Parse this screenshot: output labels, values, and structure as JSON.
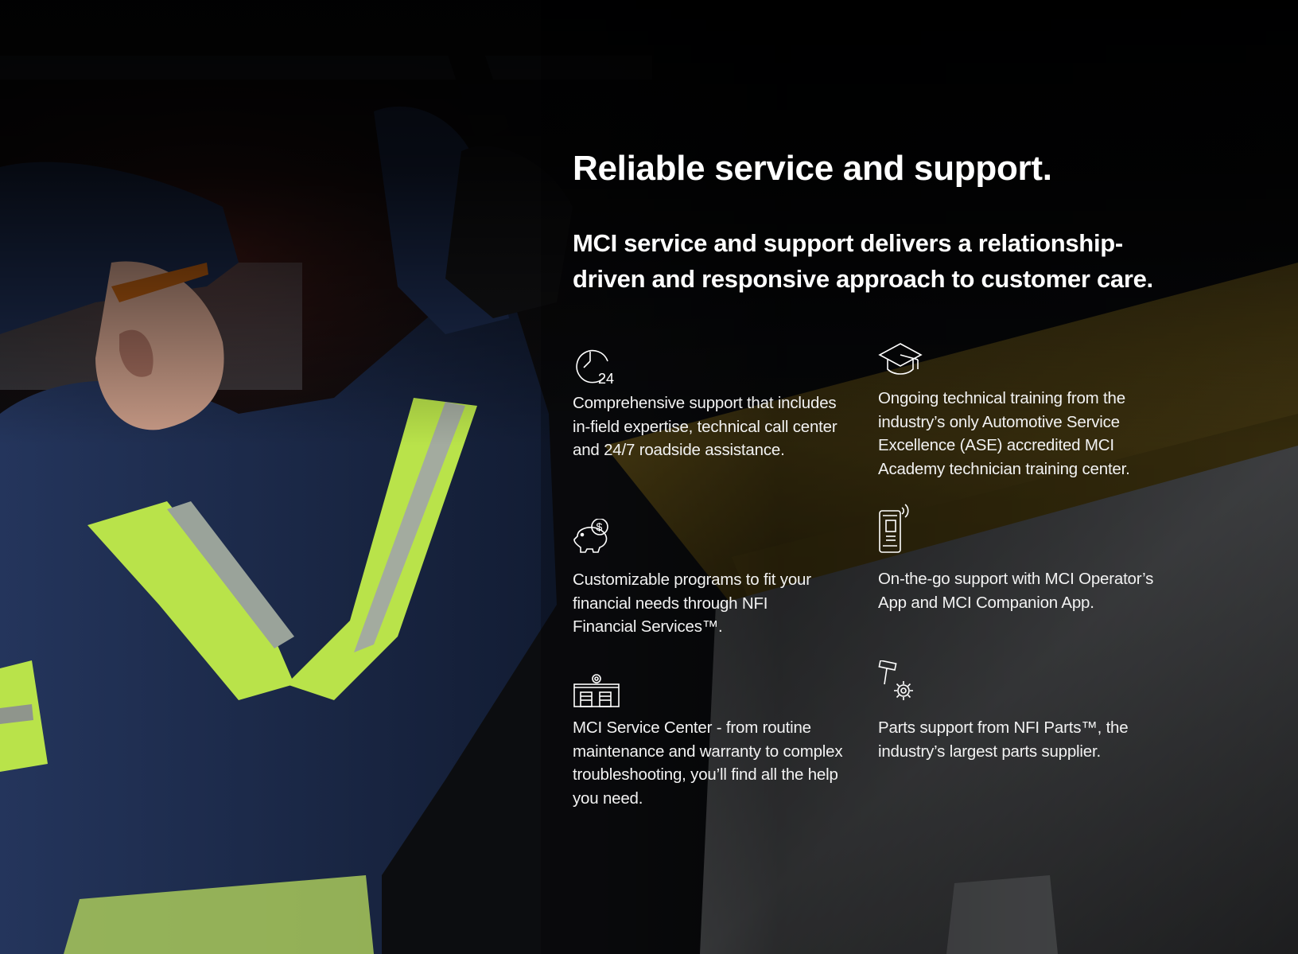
{
  "header": {
    "title": "Reliable service and support.",
    "subtitle": "MCI service and support delivers a relationship-driven and responsive approach to customer care."
  },
  "features": [
    {
      "icon": "clock-24-icon",
      "text": "Comprehensive support that includes in-field expertise, technical call center and 24/7 roadside assistance.",
      "icon_label": "24"
    },
    {
      "icon": "graduation-cap-icon",
      "text": "Ongoing technical training from the industry’s only Automotive Service Excellence (ASE) accredited MCI Academy technician training center."
    },
    {
      "icon": "piggy-bank-dollar-icon",
      "text": "Customizable programs to fit your financial needs through NFI Financial Services™.",
      "icon_label": "$"
    },
    {
      "icon": "mobile-app-icon",
      "text": "On-the-go support with MCI Operator’s App and MCI Companion App."
    },
    {
      "icon": "service-center-gear-icon",
      "text": "MCI Service Center - from routine maintenance and warranty to complex troubleshooting, you’ll find all the help you need."
    },
    {
      "icon": "parts-hammer-gear-icon",
      "text": "Parts support from NFI Parts™, the industry’s largest parts supplier."
    }
  ],
  "colors": {
    "background": "#050608",
    "text": "#ffffff",
    "uniform_navy": "#1b2a4c",
    "hi_vis_green": "#b9e34a",
    "rail_yellow": "#6e5a1a"
  }
}
